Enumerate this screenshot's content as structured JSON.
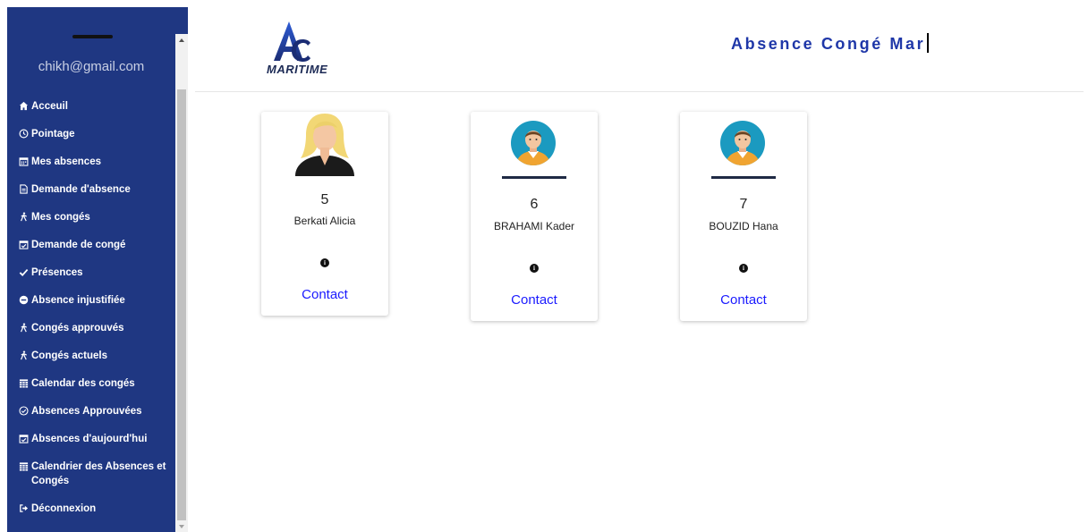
{
  "sidebar": {
    "user_email": "chikh@gmail.com",
    "items": [
      {
        "label": "Acceuil",
        "icon": "home-icon"
      },
      {
        "label": "Pointage",
        "icon": "clock-icon"
      },
      {
        "label": "Mes absences",
        "icon": "calendar-icon"
      },
      {
        "label": "Demande d'absence",
        "icon": "document-icon"
      },
      {
        "label": "Mes congés",
        "icon": "walking-icon"
      },
      {
        "label": "Demande de congé",
        "icon": "calendar-check-icon"
      },
      {
        "label": "Présences",
        "icon": "check-icon"
      },
      {
        "label": "Absence injustifiée",
        "icon": "minus-circle-icon"
      },
      {
        "label": "Congés approuvés",
        "icon": "walking-icon"
      },
      {
        "label": "Congés actuels",
        "icon": "walking-icon"
      },
      {
        "label": "Calendar des congés",
        "icon": "calendar-grid-icon"
      },
      {
        "label": "Absences Approuvées",
        "icon": "check-circle-icon"
      },
      {
        "label": "Absences d'aujourd'hui",
        "icon": "calendar-check-icon"
      },
      {
        "label": "Calendrier des Absences et Congés",
        "icon": "calendar-grid-icon"
      },
      {
        "label": "Déconnexion",
        "icon": "sign-out-icon"
      }
    ]
  },
  "header": {
    "logo_text": "MARITIME",
    "title": "Absence Congé Mar"
  },
  "employees": [
    {
      "id": "5",
      "name": "Berkati Alicia",
      "contact_label": "Contact",
      "avatar": "female-avatar"
    },
    {
      "id": "6",
      "name": "BRAHAMI Kader",
      "contact_label": "Contact",
      "avatar": "male-avatar"
    },
    {
      "id": "7",
      "name": "BOUZID Hana",
      "contact_label": "Contact",
      "avatar": "male-avatar"
    }
  ],
  "colors": {
    "sidebar_bg": "#1f3782",
    "title": "#1f37a8",
    "contact_link": "#1a1aff"
  }
}
